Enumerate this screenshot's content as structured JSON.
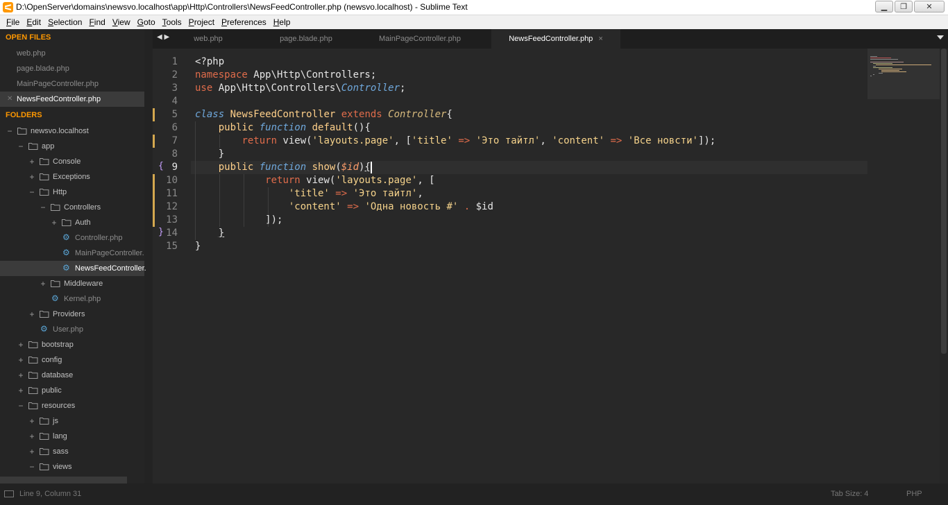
{
  "window": {
    "title": "D:\\OpenServer\\domains\\newsvo.localhost\\app\\Http\\Controllers\\NewsFeedController.php (newsvo.localhost) - Sublime Text",
    "minimize": "▁",
    "maximize": "❐",
    "close": "✕"
  },
  "menu": {
    "file": "File",
    "edit": "Edit",
    "selection": "Selection",
    "find": "Find",
    "view": "View",
    "goto": "Goto",
    "tools": "Tools",
    "project": "Project",
    "preferences": "Preferences",
    "help": "Help"
  },
  "sidebar": {
    "open_files_header": "OPEN FILES",
    "open_files": [
      "web.php",
      "page.blade.php",
      "MainPageController.php",
      "NewsFeedController.php"
    ],
    "folders_header": "FOLDERS",
    "tree": {
      "root": "newsvo.localhost",
      "app": "app",
      "console": "Console",
      "exceptions": "Exceptions",
      "http": "Http",
      "controllers": "Controllers",
      "auth": "Auth",
      "controller_php": "Controller.php",
      "mainpage_php": "MainPageController.",
      "newsfeed_php": "NewsFeedController.",
      "middleware": "Middleware",
      "kernel_php": "Kernel.php",
      "providers": "Providers",
      "user_php": "User.php",
      "bootstrap": "bootstrap",
      "config": "config",
      "database": "database",
      "public": "public",
      "resources": "resources",
      "js": "js",
      "lang": "lang",
      "sass": "sass",
      "views": "views"
    }
  },
  "tabs": {
    "arrows": "◀ ▶",
    "items": [
      "web.php",
      "page.blade.php",
      "MainPageController.php",
      "NewsFeedController.php"
    ],
    "active_close": "×"
  },
  "code": {
    "line_numbers": [
      "1",
      "2",
      "3",
      "4",
      "5",
      "6",
      "7",
      "8",
      "9",
      "10",
      "11",
      "12",
      "13",
      "14",
      "15"
    ],
    "l1": "<?php",
    "l2_kw": "namespace",
    "l2_rest": " App\\Http\\Controllers;",
    "l3_kw": "use",
    "l3_ns": " App\\Http\\Controllers\\",
    "l3_cls": "Controller",
    "l3_end": ";",
    "l5_kw": "class",
    "l5_name": " NewsFeedController ",
    "l5_ext": "extends",
    "l5_parent": " Controller",
    "l5_end": "{",
    "l6_pub": "public",
    "l6_fn": " function",
    "l6_name": " default",
    "l6_end": "(){",
    "l7_ret": "return",
    "l7_view": " view(",
    "l7_s1": "'layouts.page'",
    "l7_c1": ", [",
    "l7_s2": "'title'",
    "l7_arr1": " => ",
    "l7_s3": "'Это тайтл'",
    "l7_c2": ", ",
    "l7_s4": "'content'",
    "l7_arr2": " => ",
    "l7_s5": "'Все новсти'",
    "l7_end": "]);",
    "l8": "}",
    "l9_pub": "public",
    "l9_fn": " function",
    "l9_name": " show",
    "l9_open": "(",
    "l9_var": "$id",
    "l9_close": ")",
    "l9_brace": "{",
    "l10_ret": "return",
    "l10_view": " view(",
    "l10_s1": "'layouts.page'",
    "l10_end": ", [",
    "l11_s1": "'title'",
    "l11_arr": " => ",
    "l11_s2": "'Это тайтл'",
    "l11_end": ",",
    "l12_s1": "'content'",
    "l12_arr": " => ",
    "l12_s2": "'Одна новость #'",
    "l12_dot": " . ",
    "l12_var": "$id",
    "l13": "]);",
    "l14": "}",
    "l15": "}",
    "fold_open": "{",
    "fold_close": "}"
  },
  "status": {
    "position": "Line 9, Column 31",
    "tab_size": "Tab Size: 4",
    "syntax": "PHP"
  }
}
